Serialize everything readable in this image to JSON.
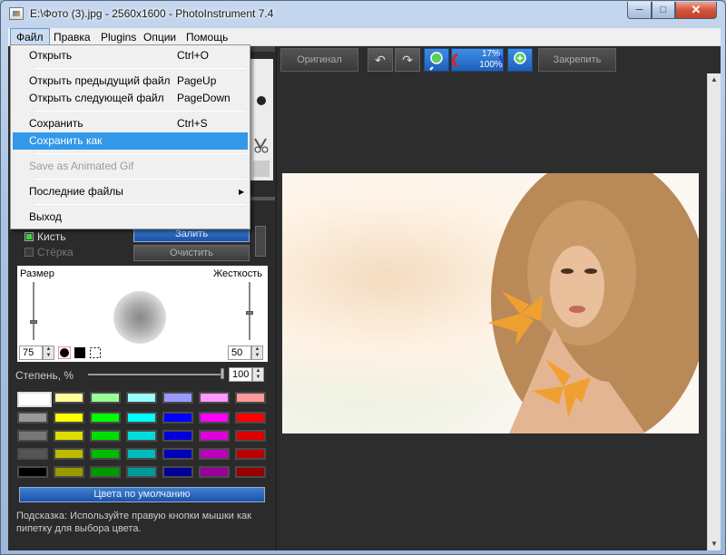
{
  "window": {
    "title": "E:\\Фото (3).jpg - 2560x1600 - PhotoInstrument 7.4",
    "min_glyph": "─",
    "max_glyph": "□",
    "close_glyph": "✕"
  },
  "menubar": {
    "items": [
      "Файл",
      "Правка",
      "Plugins",
      "Опции",
      "Помощь"
    ]
  },
  "file_menu": {
    "items": [
      {
        "label": "Открыть",
        "shortcut": "Ctrl+O"
      },
      {
        "label": "Открыть предыдущий файл",
        "shortcut": "PageUp"
      },
      {
        "label": "Открыть следующей файл",
        "shortcut": "PageDown"
      },
      {
        "label": "Сохранить",
        "shortcut": "Ctrl+S"
      },
      {
        "label": "Сохранить как",
        "shortcut": ""
      },
      {
        "label": "Save as Animated Gif",
        "shortcut": ""
      },
      {
        "label": "Последние файлы",
        "shortcut": ""
      },
      {
        "label": "Выход",
        "shortcut": ""
      }
    ],
    "submenu_arrow": "▶"
  },
  "toolbar": {
    "original_label": "Оригинал",
    "pin_label": "Закрепить",
    "undo_glyph": "↶",
    "redo_glyph": "↷",
    "zoom_pct": "17%",
    "zoom_full": "100%"
  },
  "brush_panel": {
    "fill_label": "Залить",
    "clear_label": "Очистить",
    "brush_label": "Кисть",
    "eraser_label": "Стёрка",
    "size_label": "Размер",
    "hardness_label": "Жесткость",
    "size_value": "75",
    "hardness_value": "50",
    "degree_label": "Степень, %",
    "degree_value": "100",
    "default_colors_label": "Цвета по умолчанию",
    "hint": "Подсказка: Используйте правую кнопки мышки как пипетку для выбора цвета."
  },
  "palette": {
    "rows": [
      [
        "#ffffff",
        "#ffff99",
        "#99ff99",
        "#99ffff",
        "#9999ff",
        "#ff99ff",
        "#ff9999"
      ],
      [
        "#999999",
        "#ffff00",
        "#00ff00",
        "#00ffff",
        "#0000ff",
        "#ff00ff",
        "#ff0000"
      ],
      [
        "#777777",
        "#dddd00",
        "#00dd00",
        "#00dddd",
        "#0000dd",
        "#dd00dd",
        "#dd0000"
      ],
      [
        "#555555",
        "#bbbb00",
        "#00bb00",
        "#00bbbb",
        "#0000bb",
        "#bb00bb",
        "#bb0000"
      ],
      [
        "#000000",
        "#999900",
        "#009900",
        "#009999",
        "#000099",
        "#990099",
        "#990000"
      ]
    ]
  },
  "colors": {
    "accent": "#3398e8",
    "panel_bg": "#2b2b2b",
    "canvas_bg": "#2d2d2d"
  }
}
